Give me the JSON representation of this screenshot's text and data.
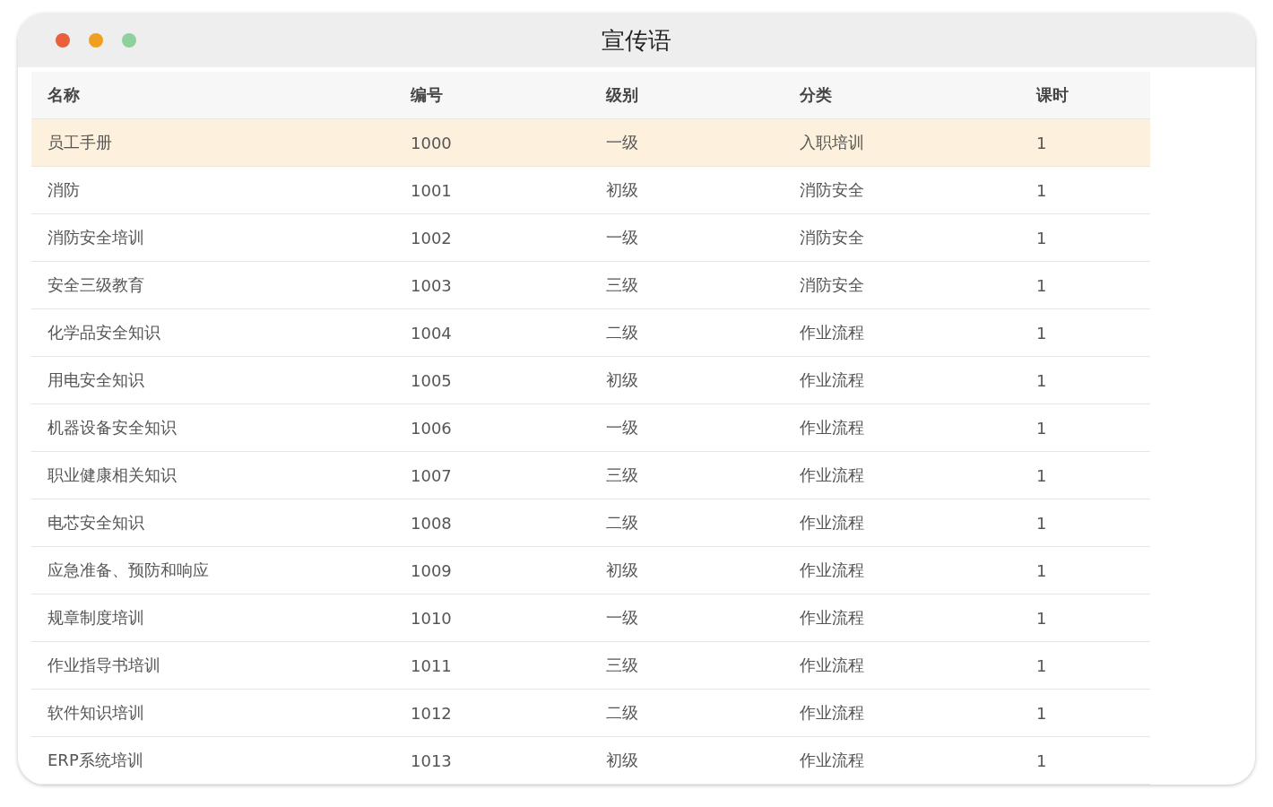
{
  "window": {
    "title": "宣传语"
  },
  "table": {
    "columns": [
      "名称",
      "编号",
      "级别",
      "分类",
      "课时"
    ],
    "rows": [
      {
        "cells": [
          "员工手册",
          "1000",
          "一级",
          "入职培训",
          "1"
        ],
        "selected": true
      },
      {
        "cells": [
          "消防",
          "1001",
          "初级",
          "消防安全",
          "1"
        ],
        "selected": false
      },
      {
        "cells": [
          "消防安全培训",
          "1002",
          "一级",
          "消防安全",
          "1"
        ],
        "selected": false
      },
      {
        "cells": [
          "安全三级教育",
          "1003",
          "三级",
          "消防安全",
          "1"
        ],
        "selected": false
      },
      {
        "cells": [
          "化学品安全知识",
          "1004",
          "二级",
          "作业流程",
          "1"
        ],
        "selected": false
      },
      {
        "cells": [
          "用电安全知识",
          "1005",
          "初级",
          "作业流程",
          "1"
        ],
        "selected": false
      },
      {
        "cells": [
          "机器设备安全知识",
          "1006",
          "一级",
          "作业流程",
          "1"
        ],
        "selected": false
      },
      {
        "cells": [
          "职业健康相关知识",
          "1007",
          "三级",
          "作业流程",
          "1"
        ],
        "selected": false
      },
      {
        "cells": [
          "电芯安全知识",
          "1008",
          "二级",
          "作业流程",
          "1"
        ],
        "selected": false
      },
      {
        "cells": [
          "应急准备、预防和响应",
          "1009",
          "初级",
          "作业流程",
          "1"
        ],
        "selected": false
      },
      {
        "cells": [
          "规章制度培训",
          "1010",
          "一级",
          "作业流程",
          "1"
        ],
        "selected": false
      },
      {
        "cells": [
          "作业指导书培训",
          "1011",
          "三级",
          "作业流程",
          "1"
        ],
        "selected": false
      },
      {
        "cells": [
          "软件知识培训",
          "1012",
          "二级",
          "作业流程",
          "1"
        ],
        "selected": false
      },
      {
        "cells": [
          "ERP系统培训",
          "1013",
          "初级",
          "作业流程",
          "1"
        ],
        "selected": false
      }
    ]
  }
}
